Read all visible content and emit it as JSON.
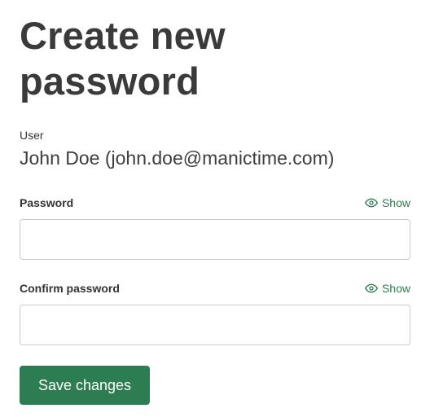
{
  "page": {
    "title": "Create new password"
  },
  "user": {
    "label": "User",
    "value": "John Doe (john.doe@manictime.com)"
  },
  "password_field": {
    "label": "Password",
    "show_label": "Show",
    "show_icon": "eye-icon",
    "value": "",
    "placeholder": ""
  },
  "confirm_field": {
    "label": "Confirm password",
    "show_label": "Show",
    "show_icon": "eye-icon",
    "value": "",
    "placeholder": ""
  },
  "actions": {
    "save_label": "Save changes"
  },
  "colors": {
    "accent": "#2e7d52",
    "text": "#3b3b3b",
    "input_border": "#c9c9c9"
  }
}
